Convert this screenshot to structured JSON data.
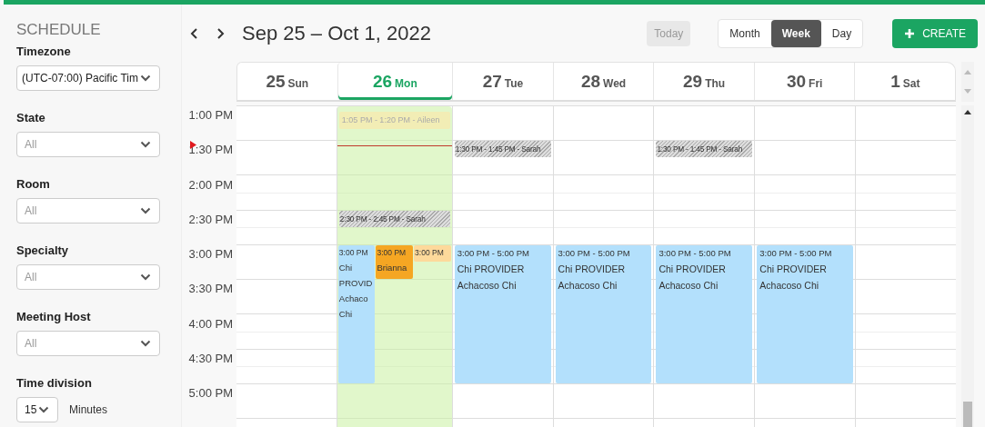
{
  "sidebar": {
    "title": "SCHEDULE",
    "filters": [
      {
        "kind": "select",
        "label": "Timezone",
        "value": "(UTC-07:00) Pacific Tim"
      },
      {
        "kind": "select",
        "label": "State",
        "placeholder": "All"
      },
      {
        "kind": "select",
        "label": "Room",
        "placeholder": "All"
      },
      {
        "kind": "select",
        "label": "Specialty",
        "placeholder": "All"
      },
      {
        "kind": "select",
        "label": "Meeting Host",
        "placeholder": "All"
      },
      {
        "kind": "number",
        "label": "Time division",
        "value": "15",
        "unit": "Minutes"
      }
    ]
  },
  "toolbar": {
    "range": "Sep 25 – Oct 1, 2022",
    "today": {
      "label": "Today",
      "disabled": true
    },
    "views": [
      {
        "label": "Month",
        "selected": false
      },
      {
        "label": "Week",
        "selected": true
      },
      {
        "label": "Day",
        "selected": false
      }
    ],
    "create": {
      "label": "CREATE"
    }
  },
  "times": [
    "1:00 PM",
    "1:30 PM",
    "2:00 PM",
    "2:30 PM",
    "3:00 PM",
    "3:30 PM",
    "4:00 PM",
    "4:30 PM",
    "5:00 PM"
  ],
  "days": [
    {
      "number": "25",
      "name": "Sun",
      "today": false,
      "now_line": false
    },
    {
      "number": "26",
      "name": "Mon",
      "today": true,
      "now_line": true,
      "events": [
        {
          "kind": "faint",
          "text": "1:05 PM - 1:20 PM - Aileen"
        },
        {
          "kind": "hatched",
          "text": "2:30 PM - 2:45 PM - Sarah"
        },
        {
          "kind": "group",
          "items": [
            {
              "kind": "tall",
              "color": "#b3e0fc",
              "time": "3:00 PM",
              "lines": [
                "Chi",
                "PROVID",
                "Achaco",
                "Chi"
              ]
            },
            {
              "kind": "medium",
              "color": "#f5a623",
              "time": "3:00 PM",
              "lines": [
                "Brianna"
              ]
            },
            {
              "kind": "short",
              "color": "#fdd99b",
              "time": "3:00 PM"
            }
          ]
        }
      ]
    },
    {
      "number": "27",
      "name": "Tue",
      "today": false,
      "now_line": false,
      "events": [
        {
          "kind": "hatched",
          "text": "1:30 PM - 1:45 PM - Sarah"
        },
        {
          "kind": "block",
          "color": "#b3e0fc",
          "time": "3:00 PM - 5:00 PM",
          "lines": [
            "Chi PROVIDER",
            "Achacoso Chi"
          ]
        }
      ]
    },
    {
      "number": "28",
      "name": "Wed",
      "today": false,
      "now_line": false,
      "events": [
        {
          "kind": "block",
          "color": "#b3e0fc",
          "time": "3:00 PM - 5:00 PM",
          "lines": [
            "Chi PROVIDER",
            "Achacoso Chi"
          ]
        }
      ]
    },
    {
      "number": "29",
      "name": "Thu",
      "today": false,
      "now_line": false,
      "events": [
        {
          "kind": "hatched",
          "text": "1:30 PM - 1:45 PM - Sarah"
        },
        {
          "kind": "block",
          "color": "#b3e0fc",
          "time": "3:00 PM - 5:00 PM",
          "lines": [
            "Chi PROVIDER",
            "Achacoso Chi"
          ]
        }
      ]
    },
    {
      "number": "30",
      "name": "Fri",
      "today": false,
      "now_line": false,
      "events": [
        {
          "kind": "block",
          "color": "#b3e0fc",
          "time": "3:00 PM - 5:00 PM",
          "lines": [
            "Chi PROVIDER",
            "Achacoso Chi"
          ]
        }
      ]
    },
    {
      "number": "1",
      "name": "Sat",
      "today": false,
      "now_line": false
    }
  ]
}
